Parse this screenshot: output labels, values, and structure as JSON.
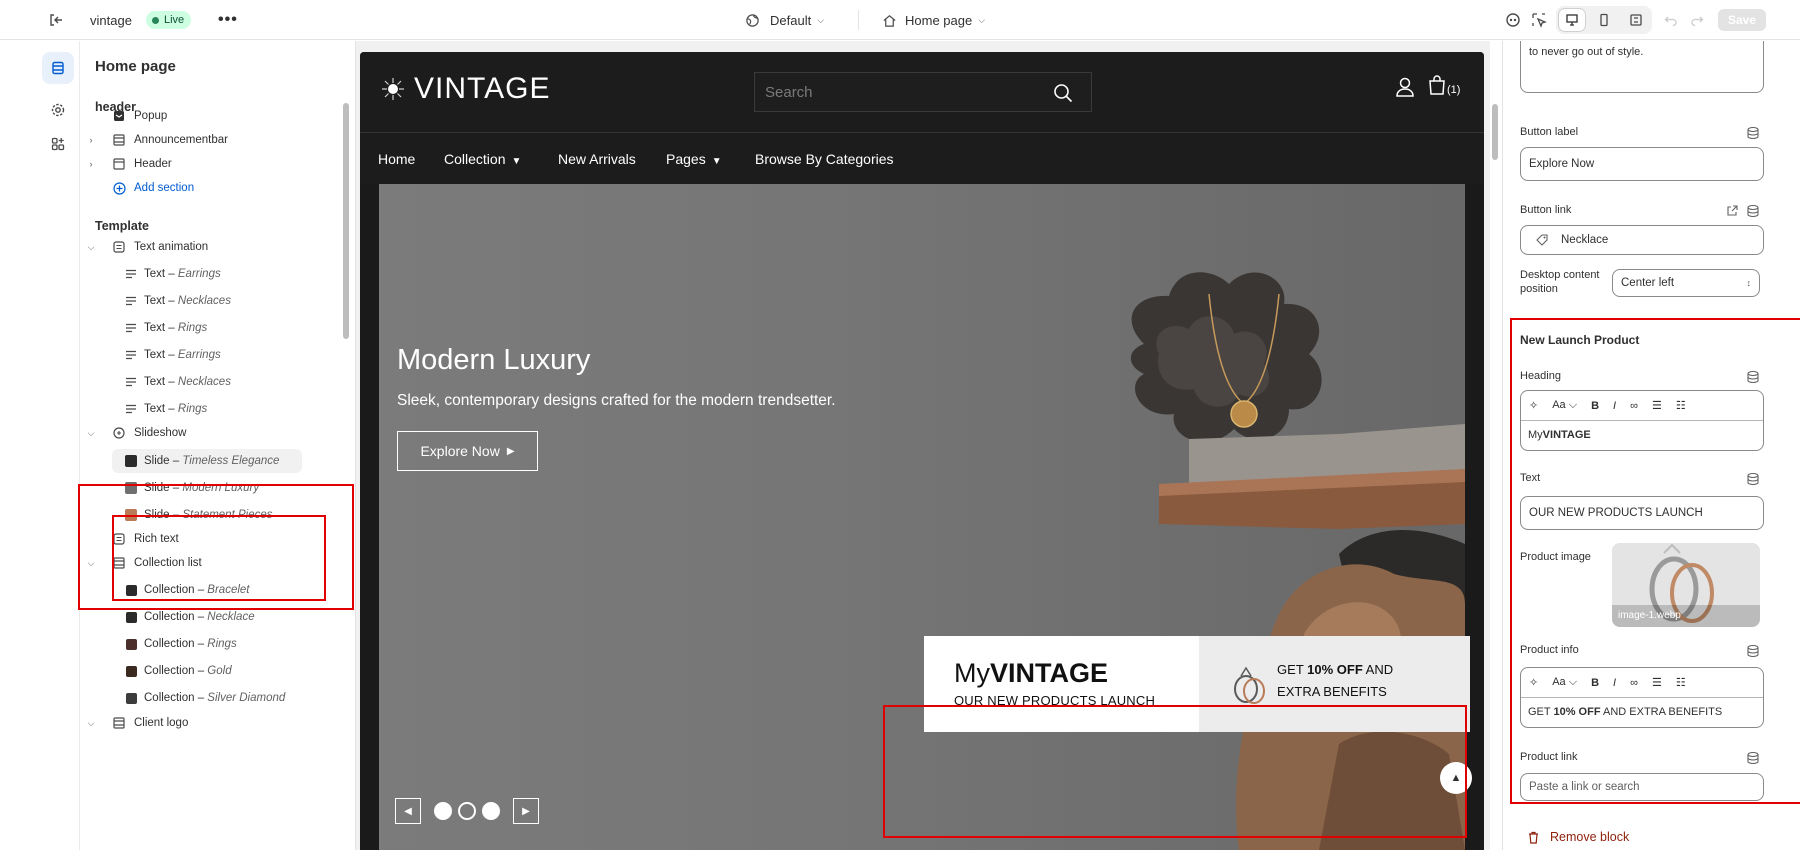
{
  "topbar": {
    "store_name": "vintage",
    "live_label": "Live",
    "more_label": "•••",
    "theme_label": "Default",
    "page_label": "Home page",
    "save_label": "Save"
  },
  "left_panel": {
    "title": "Home page",
    "header_group": "header",
    "header_items": {
      "popup": "Popup",
      "announcementbar": "Announcementbar",
      "header": "Header",
      "add_section": "Add section"
    },
    "template_group": "Template",
    "text_animation": {
      "label": "Text animation",
      "items": [
        {
          "prefix": "Text – ",
          "name": "Earrings"
        },
        {
          "prefix": "Text – ",
          "name": "Necklaces"
        },
        {
          "prefix": "Text – ",
          "name": "Rings"
        },
        {
          "prefix": "Text – ",
          "name": "Earrings"
        },
        {
          "prefix": "Text – ",
          "name": "Necklaces"
        },
        {
          "prefix": "Text – ",
          "name": "Rings"
        }
      ]
    },
    "slideshow": {
      "label": "Slideshow",
      "items": [
        {
          "prefix": "Slide – ",
          "name": "Timeless Elegance"
        },
        {
          "prefix": "Slide – ",
          "name": "Modern Luxury"
        },
        {
          "prefix": "Slide – ",
          "name": "Statement Pieces"
        }
      ]
    },
    "rich_text": "Rich text",
    "collection_list": {
      "label": "Collection list",
      "items": [
        {
          "prefix": "Collection – ",
          "name": "Bracelet"
        },
        {
          "prefix": "Collection – ",
          "name": "Necklace"
        },
        {
          "prefix": "Collection – ",
          "name": "Rings"
        },
        {
          "prefix": "Collection – ",
          "name": "Gold"
        },
        {
          "prefix": "Collection – ",
          "name": "Silver Diamond"
        }
      ]
    },
    "client_logo": "Client logo"
  },
  "preview": {
    "logo": "VINTAGE",
    "search_placeholder": "Search",
    "cart_count": "(1)",
    "nav": {
      "home": "Home",
      "collection": "Collection",
      "new_arrivals": "New Arrivals",
      "pages": "Pages",
      "browse": "Browse By Categories"
    },
    "hero": {
      "heading": "Modern Luxury",
      "subheading": "Sleek, contemporary designs crafted for the modern trendsetter.",
      "button": "Explore Now"
    },
    "launch": {
      "heading_light": "My",
      "heading_bold": "VINTAGE",
      "text": "OUR NEW PRODUCTS LAUNCH",
      "info_pre": "GET ",
      "info_bold": "10% OFF",
      "info_post": " AND EXTRA BENEFITS"
    }
  },
  "right_panel": {
    "text_value_tail": "to never go out of style.",
    "button_label_label": "Button label",
    "button_label_value": "Explore Now",
    "button_link_label": "Button link",
    "button_link_value": "Necklace",
    "desktop_position_label_1": "Desktop content",
    "desktop_position_label_2": "position",
    "desktop_position_value": "Center left",
    "block_title": "New Launch Product",
    "heading_label": "Heading",
    "heading_value_light": "My",
    "heading_value_bold": "VINTAGE",
    "text_label": "Text",
    "text_value": "OUR NEW PRODUCTS LAUNCH",
    "product_image_label": "Product image",
    "product_image_caption": "image-1.webp",
    "product_info_label": "Product info",
    "product_info_pre": "GET ",
    "product_info_bold": "10% OFF",
    "product_info_post": " AND EXTRA BENEFITS",
    "product_link_label": "Product link",
    "product_link_placeholder": "Paste a link or search",
    "remove_block": "Remove block"
  },
  "colors": {
    "accent_blue": "#005bd3",
    "live_green": "#29845a",
    "highlight_red": "#e00000",
    "danger": "#8e1f0b"
  }
}
